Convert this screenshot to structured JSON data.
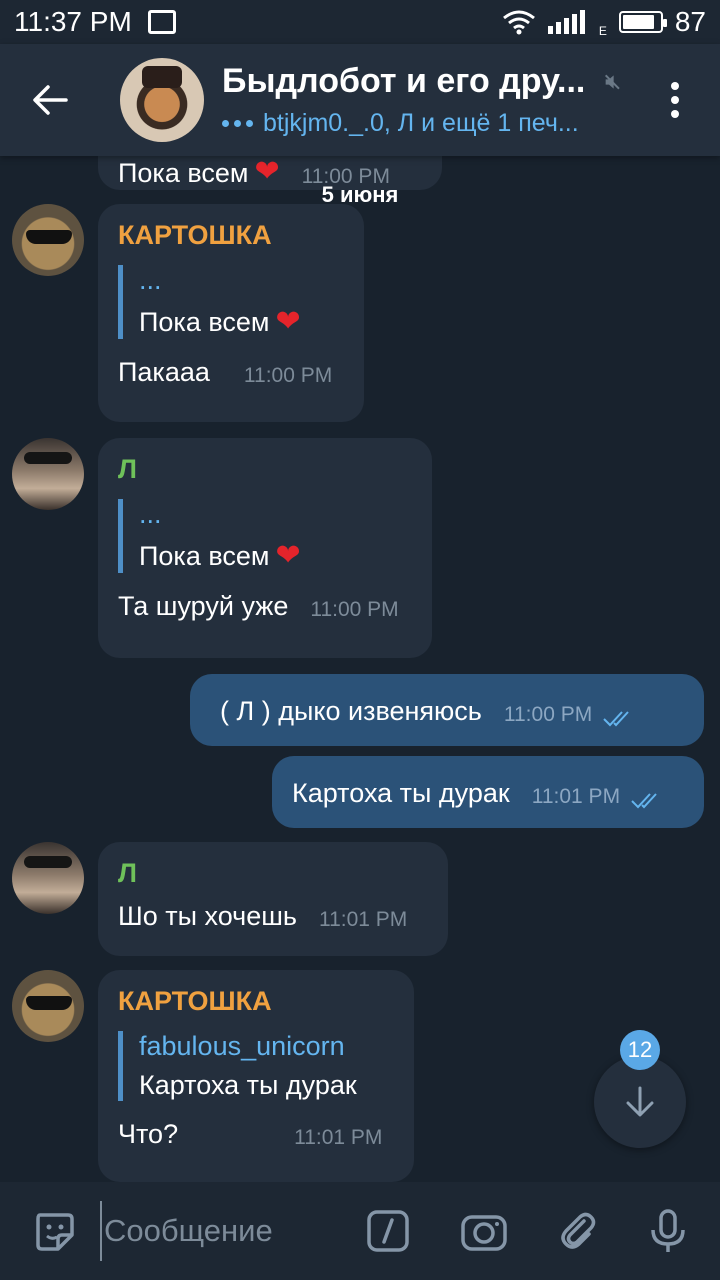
{
  "status_bar": {
    "time": "11:37 PM",
    "network_type": "E",
    "battery": "87",
    "battery_level": 0.87
  },
  "header": {
    "title": "Быдлобот и его дру...",
    "subtitle": "btjkjm0._.0, Л и ещё 1 печ..."
  },
  "date_separator": "5 июня",
  "partial_message": {
    "text": "Пока всем",
    "time": "11:00 PM"
  },
  "messages": [
    {
      "sender": "КАРТОШКА",
      "sender_color": "#f0a140",
      "reply_name": "...",
      "reply_text": "Пока всем",
      "text": "Пакааа",
      "time": "11:00 PM"
    },
    {
      "sender": "Л",
      "sender_color": "#6fc15a",
      "reply_name": "...",
      "reply_text": "Пока всем",
      "text": "Та шуруй уже",
      "time": "11:00 PM"
    },
    {
      "text": "( Л  ) дыко извеняюсь",
      "time": "11:00 PM",
      "outgoing": true
    },
    {
      "text": "Картоха ты дурак",
      "time": "11:01 PM",
      "outgoing": true
    },
    {
      "sender": "Л",
      "sender_color": "#6fc15a",
      "text": "Шо ты хочешь",
      "time": "11:01 PM"
    },
    {
      "sender": "КАРТОШКА",
      "sender_color": "#f0a140",
      "reply_name": "fabulous_unicorn",
      "reply_text": "Картоха ты дурак",
      "text": "Что?",
      "time": "11:01 PM"
    }
  ],
  "scroll_badge": "12",
  "input": {
    "placeholder": "Сообщение"
  },
  "colors": {
    "background": "#18222d",
    "header": "#242f3d",
    "incoming_bubble": "#242f3d",
    "outgoing_bubble": "#2b5278",
    "accent": "#64b5ef"
  }
}
